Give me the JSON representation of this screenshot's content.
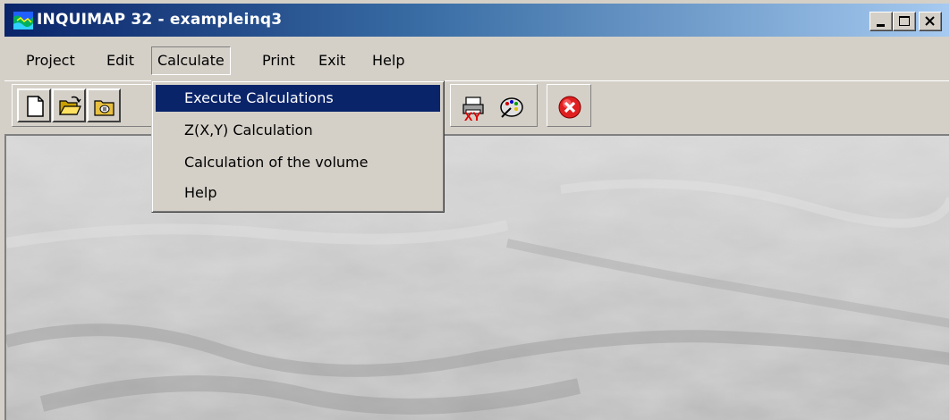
{
  "window": {
    "title": "INQUIMAP 32 - exampleinq3",
    "controls": [
      "minimize",
      "maximize",
      "close"
    ]
  },
  "menubar": {
    "items": [
      "Project",
      "Edit",
      "Calculate",
      "Print",
      "Exit",
      "Help"
    ],
    "open_menu": "Calculate"
  },
  "dropdown": {
    "items": [
      {
        "label": "Execute Calculations",
        "highlighted": true
      },
      {
        "label": "Z(X,Y) Calculation",
        "highlighted": false
      },
      {
        "label": "Calculation of the volume",
        "highlighted": false
      },
      {
        "label": "Help",
        "highlighted": false
      }
    ]
  },
  "toolbar": {
    "buttons": [
      "new-file-icon",
      "open-folder-icon",
      "folder-document-icon",
      "print-xy-icon",
      "palette-icon",
      "exit-icon"
    ]
  },
  "colors": {
    "titlebar_start": "#0a246a",
    "titlebar_end": "#a6caf0",
    "menu_highlight": "#0a246a",
    "window_face": "#d4d0c8"
  }
}
